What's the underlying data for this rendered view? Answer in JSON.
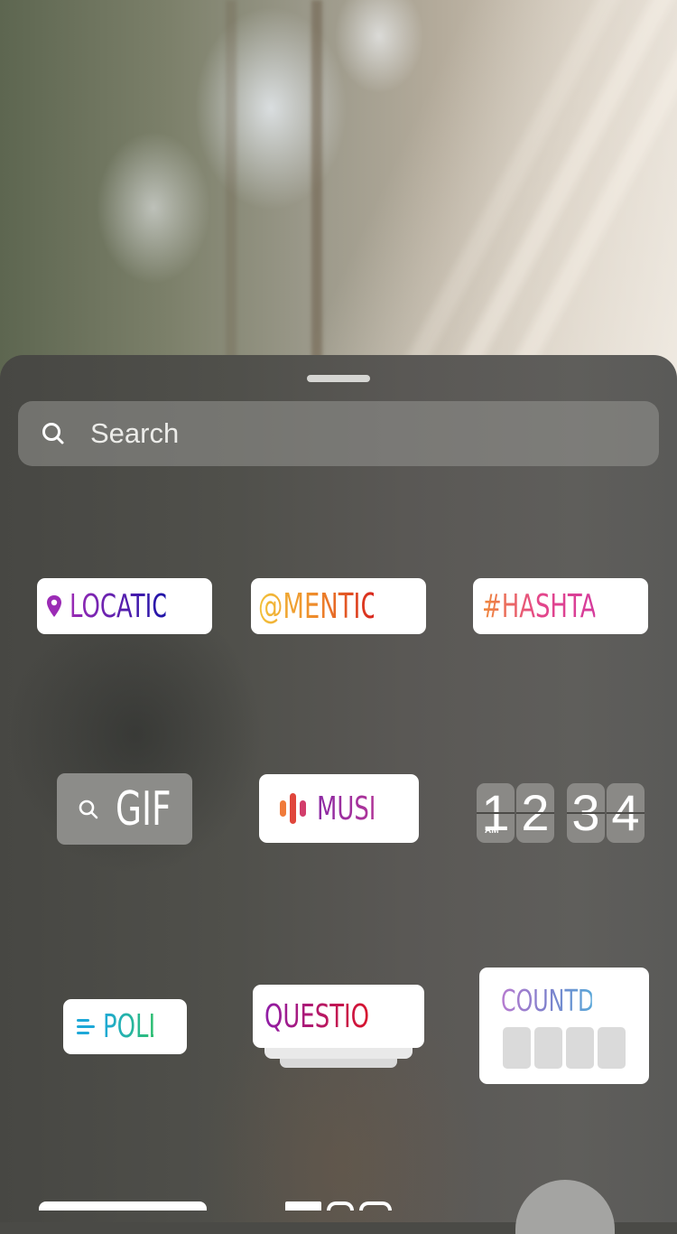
{
  "search": {
    "placeholder": "Search",
    "value": ""
  },
  "stickers": {
    "location": {
      "label": "LOCATION",
      "icon": "location-pin-icon",
      "gradient": [
        "#9b2bb5",
        "#1e14a8"
      ]
    },
    "mention": {
      "label": "@MENTION",
      "gradient": [
        "#f2c23a",
        "#ee8a2b",
        "#d8261d"
      ]
    },
    "hashtag": {
      "label": "#HASHTAG",
      "gradient": [
        "#f08a3a",
        "#e4478a",
        "#d53b9c"
      ]
    },
    "gif": {
      "label": "GIF",
      "icon": "search-icon"
    },
    "music": {
      "label": "MUSIC",
      "icon": "audio-bars-icon",
      "gradient": [
        "#8c2aa4",
        "#b03498"
      ],
      "icon_colors": [
        "#f07a3a",
        "#e0463c",
        "#d23d6b"
      ]
    },
    "clock": {
      "digits": [
        "1",
        "2",
        "3",
        "4"
      ],
      "meridiem": "AM"
    },
    "poll": {
      "label": "POLL",
      "icon": "list-lines-icon",
      "gradient": [
        "#1da8d8",
        "#2fbf72"
      ]
    },
    "questions": {
      "label": "QUESTIONS",
      "gradient": [
        "#8f1da8",
        "#d9132a"
      ]
    },
    "countdown": {
      "label": "COUNTDOWN",
      "gradient": [
        "#b77bd0",
        "#7f80cc",
        "#59a6d8"
      ],
      "cells": 4
    }
  },
  "colors": {
    "sheet_bg": "#50504b",
    "handle": "#d6d6d3",
    "search_bg": "#7a7a76",
    "sticker_bg": "#ffffff",
    "gif_bg": "#8c8c89",
    "clock_tile": "#8a8986"
  }
}
